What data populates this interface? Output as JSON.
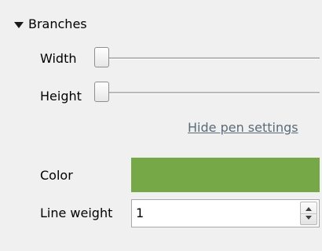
{
  "section": {
    "title": "Branches",
    "expanded": true,
    "icon": "triangle-down-icon"
  },
  "width": {
    "label": "Width",
    "value": 0
  },
  "height": {
    "label": "Height",
    "value": 0
  },
  "pen_link": {
    "label": "Hide pen settings"
  },
  "color": {
    "label": "Color",
    "hex": "#76a847"
  },
  "line_weight": {
    "label": "Line weight",
    "value": "1",
    "icon_up": "arrow-up-icon",
    "icon_down": "arrow-down-icon"
  }
}
